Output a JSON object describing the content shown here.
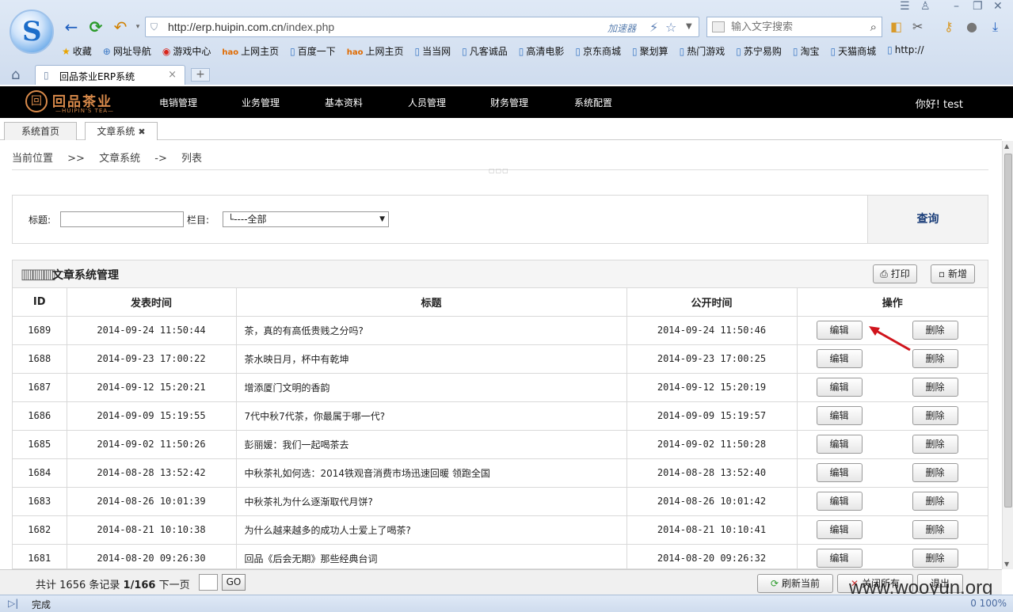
{
  "browser": {
    "url_host": "http://erp.huipin.com.cn",
    "url_path": "/index.php",
    "accelerator_label": "加速器",
    "search_placeholder": "输入文字搜索",
    "bookmarks": [
      "收藏",
      "网址导航",
      "游戏中心",
      "上网主页",
      "百度一下",
      "上网主页",
      "当当网",
      "凡客诚品",
      "高清电影",
      "京东商城",
      "聚划算",
      "热门游戏",
      "苏宁易购",
      "淘宝",
      "天猫商城",
      "http://"
    ],
    "tab_title": "回品茶业ERP系统",
    "status_text": "完成",
    "status_right": "0  100%"
  },
  "app": {
    "brand_name": "回品茶业",
    "brand_sub": "—HUIPIN'S TEA—",
    "nav": [
      "电销管理",
      "业务管理",
      "基本资料",
      "人员管理",
      "财务管理",
      "系统配置"
    ],
    "greeting": "你好! test",
    "tabs": [
      {
        "label": "系统首页"
      },
      {
        "label": "文章系统"
      }
    ],
    "tab_close": "✖"
  },
  "breadcrumb": [
    "当前位置",
    ">>",
    "文章系统",
    "->",
    "列表"
  ],
  "search": {
    "title_label": "标题:",
    "title_value": "",
    "category_label": "栏目:",
    "category_value": "└----全部",
    "query_button": "查询"
  },
  "grid": {
    "title": "文章系统管理",
    "print_button": "打印",
    "add_button": "新增",
    "columns": [
      "ID",
      "发表时间",
      "标题",
      "公开时间",
      "操作"
    ],
    "edit_label": "编辑",
    "delete_label": "删除",
    "rows": [
      {
        "id": "1689",
        "posted": "2014-09-24 11:50:44",
        "title": "茶，真的有高低贵贱之分吗?",
        "published": "2014-09-24 11:50:46"
      },
      {
        "id": "1688",
        "posted": "2014-09-23 17:00:22",
        "title": "茶水映日月，杯中有乾坤",
        "published": "2014-09-23 17:00:25"
      },
      {
        "id": "1687",
        "posted": "2014-09-12 15:20:21",
        "title": "增添厦门文明的香韵",
        "published": "2014-09-12 15:20:19"
      },
      {
        "id": "1686",
        "posted": "2014-09-09 15:19:55",
        "title": "7代中秋7代茶，你最属于哪一代?",
        "published": "2014-09-09 15:19:57"
      },
      {
        "id": "1685",
        "posted": "2014-09-02 11:50:26",
        "title": "彭丽媛：我们一起喝茶去",
        "published": "2014-09-02 11:50:28"
      },
      {
        "id": "1684",
        "posted": "2014-08-28 13:52:42",
        "title": "中秋茶礼如何选：2014铁观音消费市场迅速回暖 领跑全国",
        "published": "2014-08-28 13:52:40"
      },
      {
        "id": "1683",
        "posted": "2014-08-26 10:01:39",
        "title": "中秋茶礼为什么逐渐取代月饼?",
        "published": "2014-08-26 10:01:42"
      },
      {
        "id": "1682",
        "posted": "2014-08-21 10:10:38",
        "title": "为什么越来越多的成功人士爱上了喝茶?",
        "published": "2014-08-21 10:10:41"
      },
      {
        "id": "1681",
        "posted": "2014-08-20 09:26:30",
        "title": "回品《后会无期》那些经典台词",
        "published": "2014-08-20 09:26:32"
      }
    ]
  },
  "pager": {
    "total_prefix": "共计",
    "total_count": "1656",
    "total_suffix": "条记录",
    "page_info": "1/166",
    "next_label": "下一页",
    "go_label": "GO",
    "refresh_button": "刷新当前",
    "close_all_button": "关闭所有",
    "exit_button": "退出"
  },
  "watermark": "www.wooyun.org",
  "colors": {
    "header_bg": "#000000",
    "brand": "#d98a4a",
    "query_text": "#1c3f7a",
    "annotation_arrow": "#d0141c"
  }
}
